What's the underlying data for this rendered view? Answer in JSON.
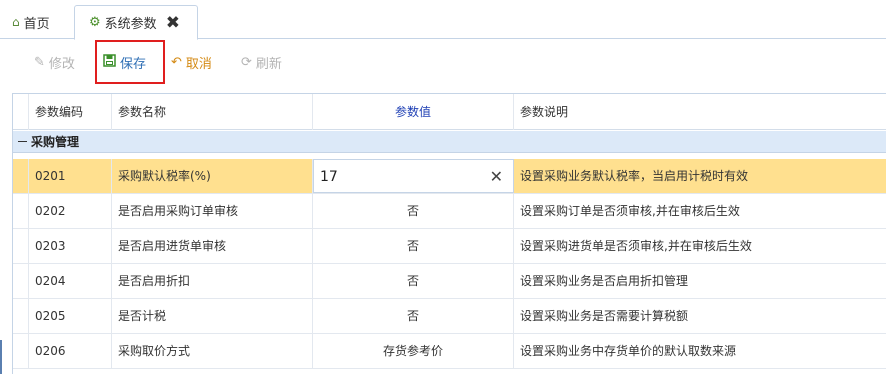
{
  "tabs": {
    "home_label": "首页",
    "active_label": "系统参数"
  },
  "toolbar": {
    "edit_label": "修改",
    "save_label": "保存",
    "cancel_label": "取消",
    "refresh_label": "刷新"
  },
  "grid": {
    "columns": {
      "code": "参数编码",
      "name": "参数名称",
      "value": "参数值",
      "desc": "参数说明"
    },
    "group_label": "采购管理",
    "rows": [
      {
        "code": "0201",
        "name": "采购默认税率(%)",
        "value": "17",
        "desc": "设置采购业务默认税率，当启用计税时有效"
      },
      {
        "code": "0202",
        "name": "是否启用采购订单审核",
        "value": "否",
        "desc": "设置采购订单是否须审核,并在审核后生效"
      },
      {
        "code": "0203",
        "name": "是否启用进货单审核",
        "value": "否",
        "desc": "设置采购进货单是否须审核,并在审核后生效"
      },
      {
        "code": "0204",
        "name": "是否启用折扣",
        "value": "否",
        "desc": "设置采购业务是否启用折扣管理"
      },
      {
        "code": "0205",
        "name": "是否计税",
        "value": "否",
        "desc": "设置采购业务是否需要计算税额"
      },
      {
        "code": "0206",
        "name": "采购取价方式",
        "value": "存货参考价",
        "desc": "设置采购业务中存货单价的默认取数来源"
      }
    ]
  },
  "colors": {
    "selected_row": "#ffe08f",
    "group_row": "#dce9f8",
    "highlight_border": "#e01e1e"
  }
}
